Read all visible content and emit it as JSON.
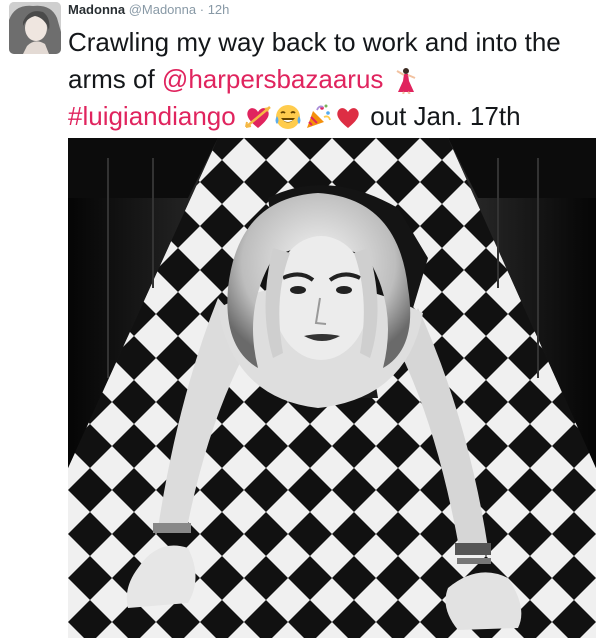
{
  "tweet": {
    "display_name": "Madonna",
    "handle": "@Madonna",
    "separator": "·",
    "time": "12h",
    "text_line1": "Crawling my way back to work and into the",
    "text_line2_prefix": "arms of ",
    "mention": "@harpersbazaarus",
    "hashtag": "#luigiandiango",
    "text_line3_suffix": "out Jan. 17th",
    "emojis": [
      "dancer-emoji",
      "heart-arrow-emoji",
      "tears-of-joy-emoji",
      "party-popper-emoji",
      "red-heart-emoji"
    ]
  },
  "colors": {
    "link": "#e0245e",
    "text": "#14171a",
    "meta": "#8899a6"
  }
}
